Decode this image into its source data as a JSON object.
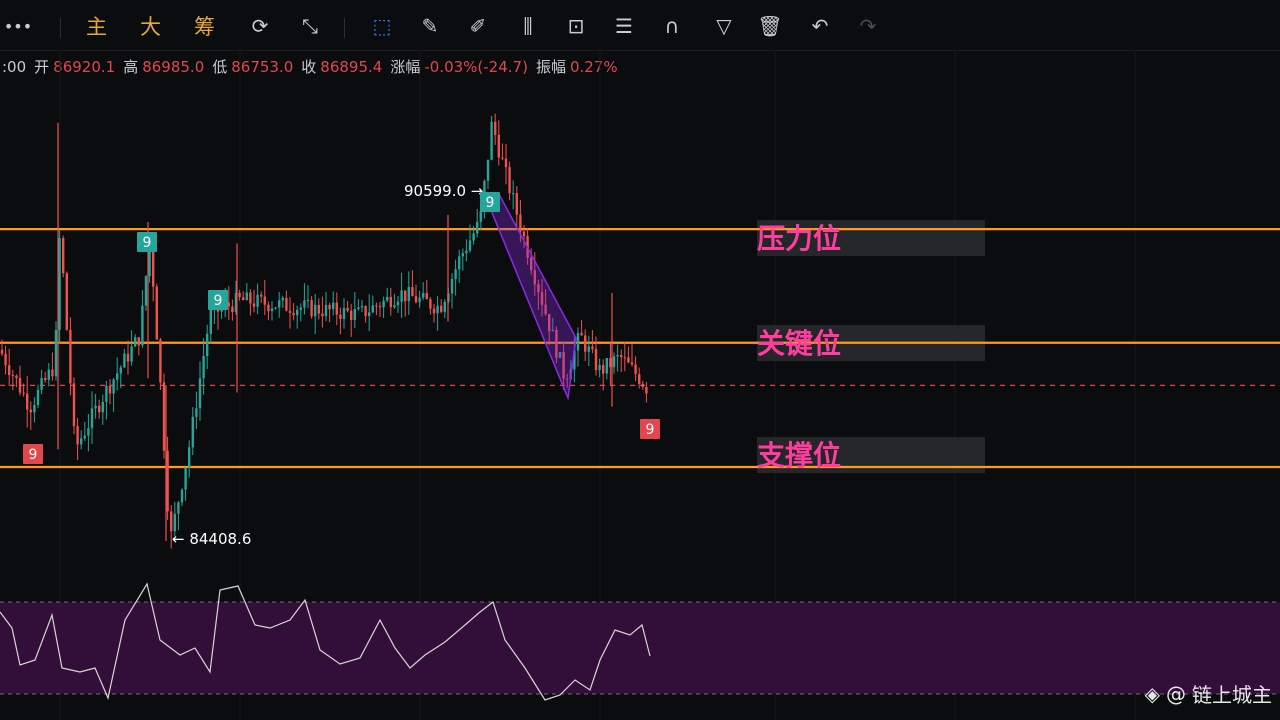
{
  "toolbar": {
    "more": "•••",
    "tabs": [
      "主",
      "大",
      "筹"
    ],
    "icons": [
      "sync-icon",
      "draw-line-icon",
      "select-icon",
      "ruler-icon",
      "pen-icon",
      "candles-icon",
      "lock-icon",
      "note-icon",
      "magnet-icon",
      "filter-icon",
      "delete-icon",
      "undo-icon",
      "redo-icon"
    ]
  },
  "info": {
    "time": ":00",
    "open_label": "开",
    "open": "86920.1",
    "high_label": "高",
    "high": "86985.0",
    "low_label": "低",
    "low": "86753.0",
    "close_label": "收",
    "close": "86895.4",
    "change_label": "涨幅",
    "change": "-0.03%(-24.7)",
    "amplitude_label": "振幅",
    "amplitude": "0.27%"
  },
  "zones": [
    {
      "label": "压力位",
      "price": 88800
    },
    {
      "label": "关键位",
      "price": 87200
    },
    {
      "label": "支撑位",
      "price": 85450
    }
  ],
  "colors": {
    "up": "#26a69a",
    "down": "#ef5350",
    "level": "#ff9a1f",
    "zone_label": "#ff3d9e",
    "channel": "#8a2be2",
    "indicator_bg": "#3a1040"
  },
  "watermark": "链上城主",
  "chart_data": {
    "type": "candlestick",
    "high_marker": "90599.0",
    "low_marker": "84408.6",
    "ylim": [
      84000,
      90900
    ],
    "current_price": 86600,
    "markers": [
      {
        "text": "9",
        "x": 33,
        "kind": "down"
      },
      {
        "text": "9",
        "x": 147,
        "kind": "up"
      },
      {
        "text": "9",
        "x": 218,
        "kind": "up"
      },
      {
        "text": "9",
        "x": 490,
        "kind": "up"
      },
      {
        "text": "9",
        "x": 650,
        "kind": "down"
      }
    ]
  }
}
